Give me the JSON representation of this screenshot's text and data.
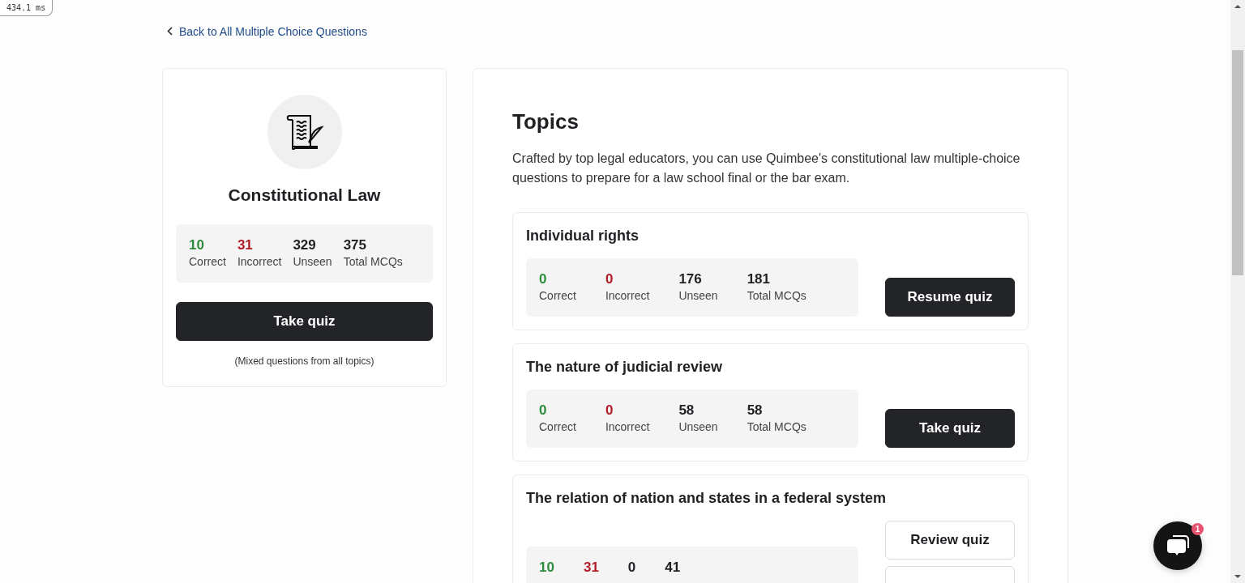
{
  "timing_badge": "434.1 ms",
  "back_link": "Back to All Multiple Choice Questions",
  "subject": {
    "title": "Constitutional Law",
    "stats": [
      {
        "kind": "correct",
        "value": "10",
        "label": "Correct"
      },
      {
        "kind": "incorrect",
        "value": "31",
        "label": "Incorrect"
      },
      {
        "kind": "unseen",
        "value": "329",
        "label": "Unseen"
      },
      {
        "kind": "total",
        "value": "375",
        "label": "Total MCQs"
      }
    ],
    "button": "Take quiz",
    "note": "(Mixed questions from all topics)"
  },
  "topics_panel": {
    "title": "Topics",
    "description": "Crafted by top legal educators, you can use Quimbee's constitutional law multiple-choice questions to prepare for a law school final or the bar exam.",
    "topics": [
      {
        "title": "Individual rights",
        "stats": [
          {
            "kind": "correct",
            "value": "0",
            "label": "Correct"
          },
          {
            "kind": "incorrect",
            "value": "0",
            "label": "Incorrect"
          },
          {
            "kind": "unseen",
            "value": "176",
            "label": "Unseen"
          },
          {
            "kind": "total",
            "value": "181",
            "label": "Total MCQs"
          }
        ],
        "buttons": [
          {
            "kind": "primary",
            "label": "Resume quiz"
          }
        ]
      },
      {
        "title": "The nature of judicial review",
        "stats": [
          {
            "kind": "correct",
            "value": "0",
            "label": "Correct"
          },
          {
            "kind": "incorrect",
            "value": "0",
            "label": "Incorrect"
          },
          {
            "kind": "unseen",
            "value": "58",
            "label": "Unseen"
          },
          {
            "kind": "total",
            "value": "58",
            "label": "Total MCQs"
          }
        ],
        "buttons": [
          {
            "kind": "primary",
            "label": "Take quiz"
          }
        ]
      },
      {
        "title": "The relation of nation and states in a federal system",
        "stats": [
          {
            "kind": "correct",
            "value": "10"
          },
          {
            "kind": "incorrect",
            "value": "31"
          },
          {
            "kind": "unseen",
            "value": "0"
          },
          {
            "kind": "total",
            "value": "41"
          }
        ],
        "buttons": [
          {
            "kind": "secondary",
            "label": "Review quiz"
          },
          {
            "kind": "secondary"
          }
        ]
      }
    ]
  },
  "chat": {
    "badge": "1"
  }
}
